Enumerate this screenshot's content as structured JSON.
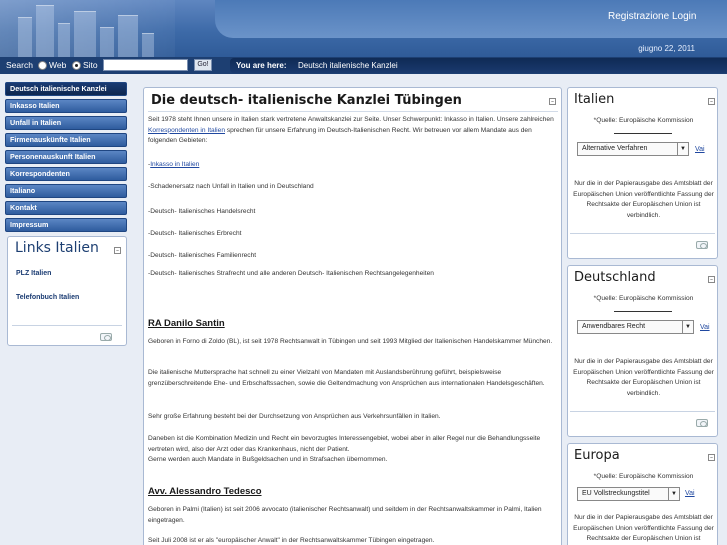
{
  "header": {
    "links": [
      "Registrazione",
      "Login"
    ],
    "date": "giugno 22, 2011"
  },
  "search": {
    "label": "Search",
    "options": [
      "Web",
      "Sito"
    ],
    "selected": "Sito",
    "value": "",
    "go_label": "Go!"
  },
  "breadcrumb": {
    "prefix": "You are here:",
    "current": "Deutsch italienische Kanzlei"
  },
  "nav": {
    "items": [
      "Deutsch italienische Kanzlei",
      "Inkasso Italien",
      "Unfall in Italien",
      "Firmenauskünfte Italien",
      "Personenauskunft Italien",
      "Korrespondenten",
      "Italiano",
      "Kontakt",
      "Impressum"
    ],
    "active_index": 0
  },
  "links_box": {
    "title": "Links Italien",
    "links": [
      "PLZ Italien",
      "Telefonbuch Italien"
    ]
  },
  "main": {
    "title": "Die deutsch- italienische Kanzlei Tübingen",
    "intro_a": "Seit 1978 steht Ihnen unsere in Italien stark vertretene Anwaltskanzlei zur Seite. Unser Schwerpunkt: Inkasso in Italien. Unsere zahlreichen ",
    "intro_link": "Korrespondenten in Italien",
    "intro_b": " sprechen für unsere Erfahrung im Deutsch-Italienischen Recht. Wir betreuen vor allem Mandate aus den folgenden Gebieten:",
    "list_link": "Inkasso in Italien",
    "list": [
      "-Schadenersatz nach Unfall in Italien und in Deutschland",
      "-Deutsch- Italienisches Handelsrecht",
      "-Deutsch- Italienisches Erbrecht",
      "-Deutsch- Italienisches Familienrecht",
      "-Deutsch- Italienisches Strafrecht und alle anderen Deutsch- Italienischen Rechtsangelegenheiten"
    ],
    "lawyer1_name": "RA Danilo Santin",
    "lawyer1_p1": "Geboren in Forno di Zoldo (BL), ist seit 1978 Rechtsanwalt in Tübingen und seit 1993 Mitglied der Italienischen Handelskammer München.",
    "lawyer1_p2": "Die italienische Muttersprache hat schnell zu einer Vielzahl von Mandaten mit Auslandsberührung geführt, beispielsweise grenzüberschreitende Ehe- und Erbschaftssachen, sowie die Geltendmachung von Ansprüchen aus internationalen Handelsgeschäften.",
    "lawyer1_p3": "Sehr große Erfahrung besteht bei der Durchsetzung von Ansprüchen aus Verkehrsunfällen in Italien.",
    "lawyer1_p4a": "Daneben ist die Kombination Medizin und Recht ein bevorzugtes Interessengebiet, wobei aber in aller Regel nur die Behandlungsseite vertreten wird, also der Arzt oder das Krankenhaus, nicht der Patient.",
    "lawyer1_p4b": "Gerne werden auch Mandate in Bußgeldsachen und in Strafsachen übernommen.",
    "lawyer2_name": "Avv. Alessandro Tedesco",
    "lawyer2_p1": "Geboren in Palmi (Italien) ist seit 2006 avvocato  (italienischer Rechtsanwalt) und seitdem in der    Rechtsanwaltskammer in Palmi, Italien eingetragen.",
    "lawyer2_p2": "Seit Juli 2008 ist er als \"europäischer Anwalt\" in der Rechtsanwaltskammer Tübingen eingetragen."
  },
  "right_boxes": [
    {
      "title": "Italien",
      "source": "*Quelle: Europäische Kommission",
      "select": "Alternative Verfahren",
      "go": "Vai",
      "note": "Nur die in der Papierausgabe des Amtsblatt der Europäischen Union veröffentlichte Fassung der Rechtsakte der Europäischen Union ist verbindlich."
    },
    {
      "title": "Deutschland",
      "source": "*Quelle: Europäische Kommission",
      "select": "Anwendbares Recht",
      "go": "Vai",
      "note": "Nur die in der Papierausgabe des Amtsblatt der Europäischen Union veröffentlichte Fassung der Rechtsakte der Europäischen Union ist verbindlich."
    },
    {
      "title": "Europa",
      "source": "*Quelle: Europäische Kommission",
      "select": "EU Vollstreckungstitel",
      "go": "Vai",
      "note": "Nur die in der Papierausgabe des Amtsblatt der Europäischen Union veröffentlichte Fassung der Rechtsakte der Europäischen Union ist verbindlich."
    }
  ]
}
